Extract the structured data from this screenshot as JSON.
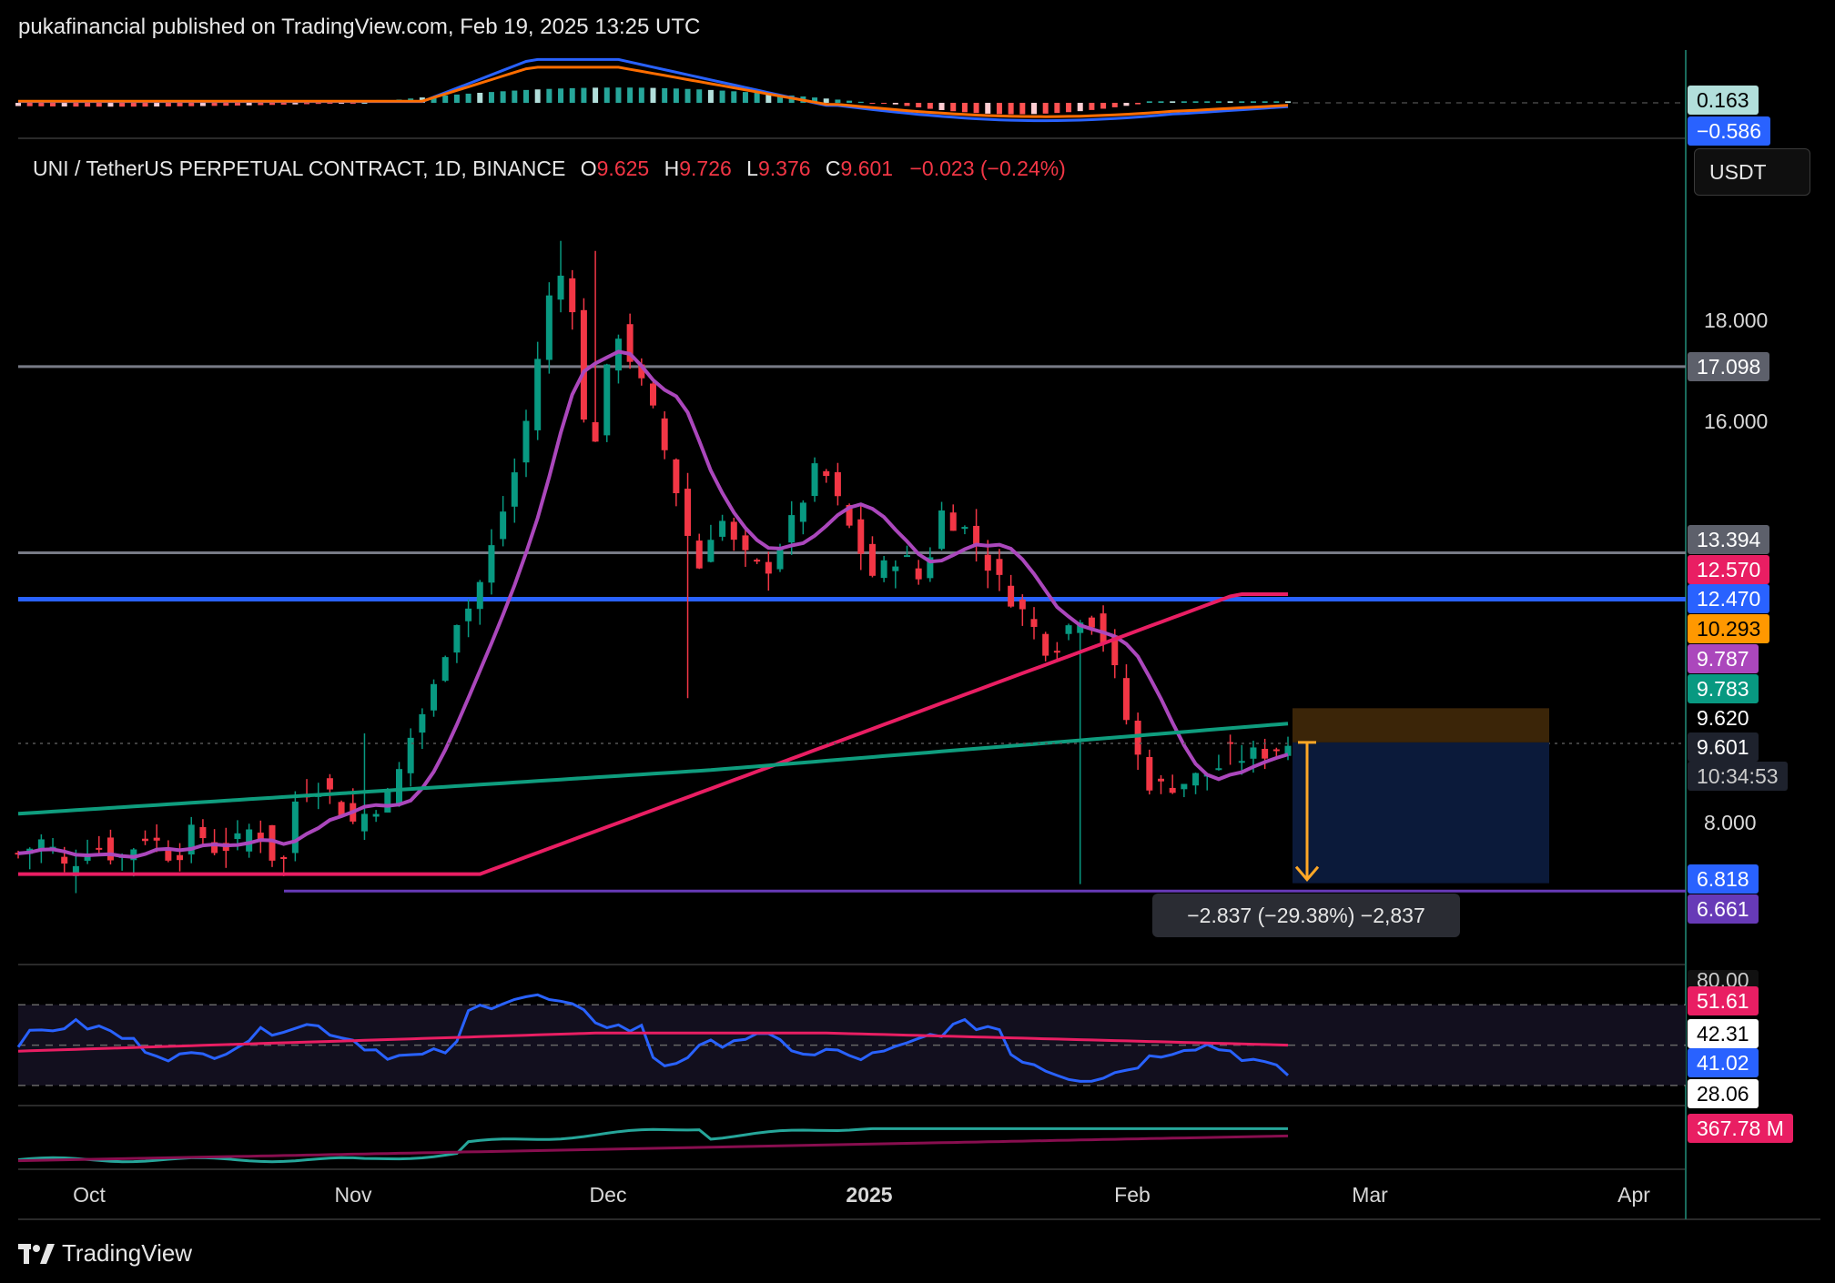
{
  "header": {
    "published": "pukafinancial published on TradingView.com, Feb 19, 2025 13:25 UTC"
  },
  "legend": {
    "symbol": "UNI / TetherUS PERPETUAL CONTRACT, 1D, BINANCE",
    "o_label": "O",
    "o": "9.625",
    "h_label": "H",
    "h": "9.726",
    "l_label": "L",
    "l": "9.376",
    "c_label": "C",
    "c": "9.601",
    "change": "−0.023 (−0.24%)"
  },
  "currency_button": "USDT",
  "footer": {
    "brand": "TradingView"
  },
  "measure_label": "−2.837 (−29.38%) −2,837",
  "colors": {
    "up": "#089981",
    "down": "#f23645",
    "ma_purple": "#ab47bc",
    "ma_pink": "#e91e63",
    "ma_teal": "#0f9d7e",
    "hline_blue": "#2962ff",
    "hline_gray": "#787b86",
    "support": "#673ab7",
    "macd_blue": "#2962ff",
    "macd_orange": "#ff6d00",
    "vol_ma": "#880e4f"
  },
  "chart_data": [
    {
      "type": "candlestick",
      "pane": "price",
      "ylim": [
        5.2,
        20.5
      ],
      "y_ticks": [
        "18.000",
        "16.000",
        "8.000"
      ],
      "x_ticks": [
        "Oct",
        "Nov",
        "Dec",
        "2025",
        "Feb",
        "Mar",
        "Apr"
      ],
      "horizontal_lines": [
        {
          "value": 17.098,
          "color": "#787b86"
        },
        {
          "value": 13.394,
          "color": "#787b86"
        },
        {
          "value": 12.47,
          "color": "#2962ff"
        },
        {
          "value": 6.661,
          "color": "#673ab7"
        }
      ],
      "price_badges": [
        {
          "text": "17.098",
          "bg": "#5d606b",
          "fg": "#ffffff",
          "value": 17.098
        },
        {
          "text": "13.394",
          "bg": "#5d606b",
          "fg": "#ffffff",
          "value": 13.65
        },
        {
          "text": "12.570",
          "bg": "#e91e63",
          "fg": "#ffffff",
          "value": 13.06
        },
        {
          "text": "12.470",
          "bg": "#2962ff",
          "fg": "#ffffff",
          "value": 12.47
        },
        {
          "text": "10.293",
          "bg": "#ff9800",
          "fg": "#000000",
          "value": 11.88
        },
        {
          "text": "9.787",
          "bg": "#ab47bc",
          "fg": "#ffffff",
          "value": 11.28
        },
        {
          "text": "9.783",
          "bg": "#089981",
          "fg": "#ffffff",
          "value": 10.68
        },
        {
          "text": "9.620",
          "bg": "#000000",
          "fg": "#ffffff",
          "value": 10.1
        },
        {
          "text": "9.601",
          "bg": "#1e222d",
          "fg": "#ffffff",
          "value": 9.52
        },
        {
          "text": "10:34:53",
          "bg": "#1e222d",
          "fg": "#cccccc",
          "value": 8.95
        },
        {
          "text": "6.818",
          "bg": "#2962ff",
          "fg": "#ffffff",
          "value": 6.9
        },
        {
          "text": "6.661",
          "bg": "#673ab7",
          "fg": "#ffffff",
          "value": 6.3
        }
      ],
      "position_tool": {
        "entry": 9.62,
        "stop": 10.3,
        "target": 6.818
      }
    },
    {
      "type": "macd",
      "pane": "macd",
      "values_shown": [
        "0.163",
        "−0.586"
      ]
    },
    {
      "type": "line",
      "pane": "rsi",
      "levels": [
        "80.00",
        "51.61",
        "42.31",
        "41.02",
        "28.06"
      ]
    },
    {
      "type": "line",
      "pane": "volume",
      "last_value": "367.78 M"
    }
  ]
}
